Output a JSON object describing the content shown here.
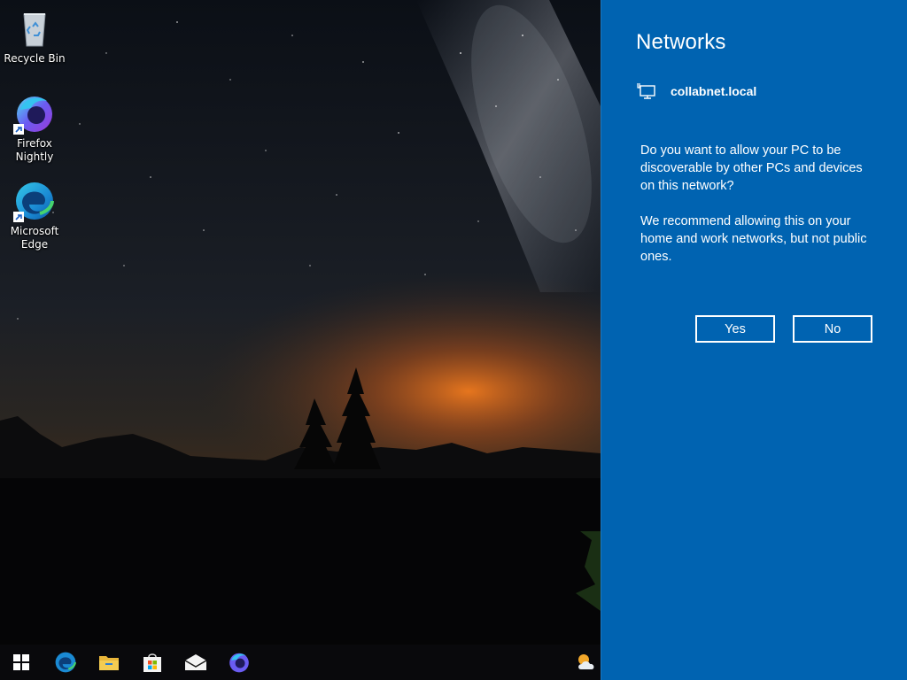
{
  "desktop": {
    "icons": [
      {
        "label_line1": "Recycle Bin",
        "label_line2": "",
        "icon": "recycle-bin-icon"
      },
      {
        "label_line1": "Firefox",
        "label_line2": "Nightly",
        "icon": "firefox-nightly-icon"
      },
      {
        "label_line1": "Microsoft",
        "label_line2": "Edge",
        "icon": "edge-icon"
      }
    ]
  },
  "taskbar": {
    "buttons": [
      {
        "icon": "windows-start-icon"
      },
      {
        "icon": "edge-icon"
      },
      {
        "icon": "file-explorer-icon"
      },
      {
        "icon": "microsoft-store-icon"
      },
      {
        "icon": "mail-icon"
      },
      {
        "icon": "firefox-nightly-icon"
      }
    ],
    "tray": [
      {
        "icon": "weather-icon"
      }
    ]
  },
  "networks_panel": {
    "title": "Networks",
    "network_name": "collabnet.local",
    "network_icon": "ethernet-icon",
    "question": "Do you want to allow your PC to be discoverable by other PCs and devices on this network?",
    "recommendation": "We recommend allowing this on your home and work networks, but not public ones.",
    "yes_label": "Yes",
    "no_label": "No",
    "background_color": "#0063b1"
  }
}
